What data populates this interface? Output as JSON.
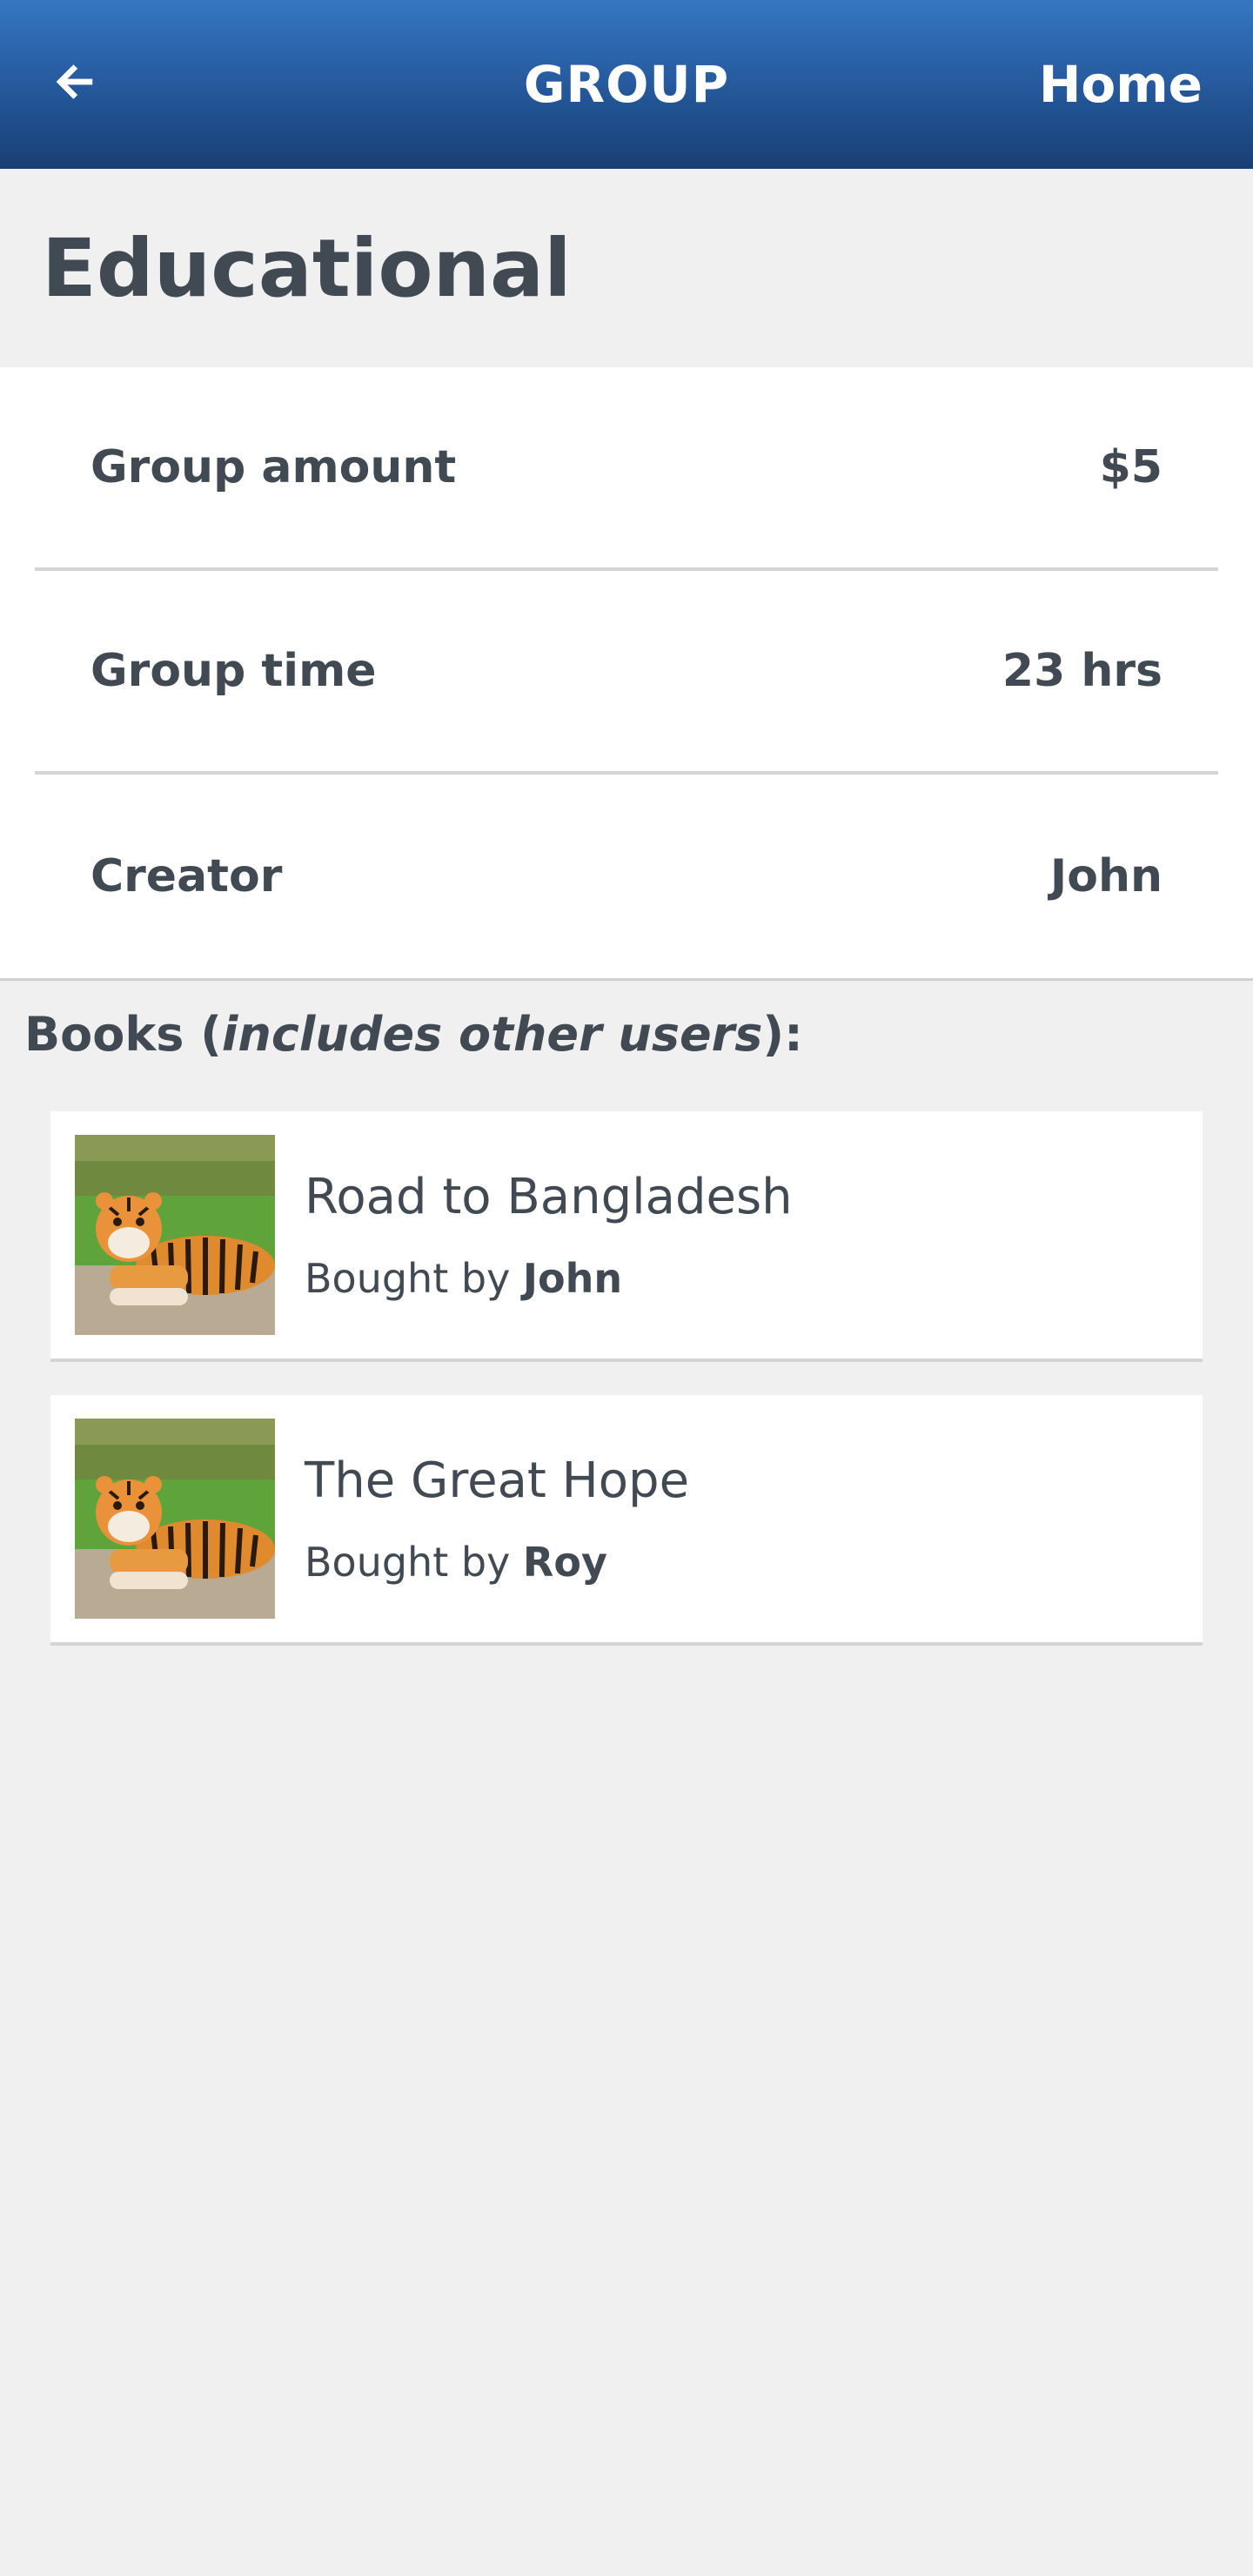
{
  "header": {
    "back_icon": "arrow-left-icon",
    "title": "GROUP",
    "home_label": "Home"
  },
  "group": {
    "name": "Educational",
    "details": [
      {
        "label": "Group amount",
        "value": "$5"
      },
      {
        "label": "Group time",
        "value": "23 hrs"
      },
      {
        "label": "Creator",
        "value": "John"
      }
    ]
  },
  "books_section": {
    "heading_prefix": "Books (",
    "heading_emphasis": "includes other users",
    "heading_suffix": "):"
  },
  "books": [
    {
      "title": "Road to Bangladesh",
      "bought_by_label": "Bought by ",
      "buyer": "John",
      "thumbnail": "tiger-image"
    },
    {
      "title": "The Great Hope",
      "bought_by_label": "Bought by ",
      "buyer": "Roy",
      "thumbnail": "tiger-image"
    }
  ],
  "colors": {
    "header_top": "#3576c2",
    "header_bottom": "#183f74",
    "text": "#414952",
    "page_background": "#f0f0f0"
  }
}
